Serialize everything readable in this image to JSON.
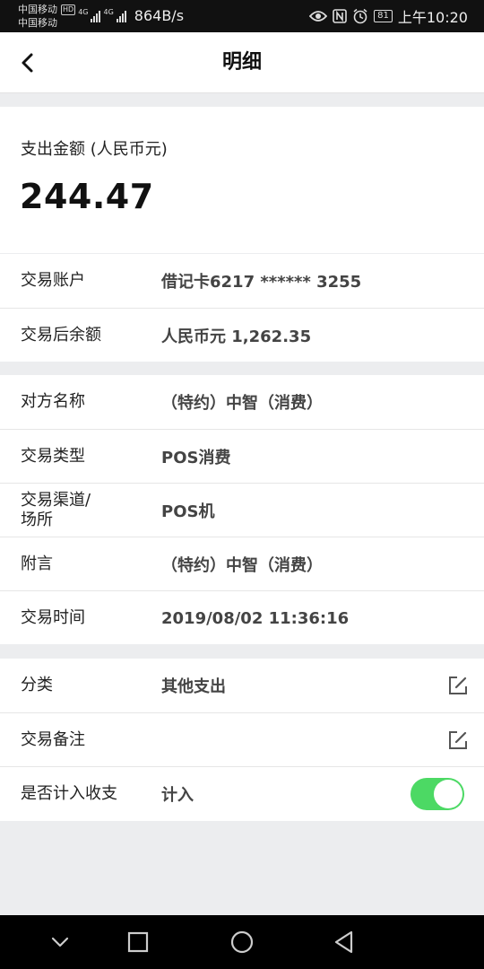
{
  "status_bar": {
    "carrier1": "中国移动",
    "carrier2": "中国移动",
    "hd": "HD",
    "net1": "4G",
    "net2": "4G",
    "speed": "864B/s",
    "battery": "81",
    "time": "上午10:20",
    "icons": [
      "eye-icon",
      "nfc-icon",
      "alarm-icon"
    ]
  },
  "header": {
    "title": "明细",
    "back_icon": "chevron-left-icon"
  },
  "amount": {
    "label": "支出金额 (人民币元)",
    "value": "244.47"
  },
  "section1": [
    {
      "label": "交易账户",
      "value": "借记卡6217 ****** 3255"
    },
    {
      "label": "交易后余额",
      "value": "人民币元 1,262.35"
    }
  ],
  "section2": [
    {
      "label": "对方名称",
      "value": "（特约）中智（消费）"
    },
    {
      "label": "交易类型",
      "value": "POS消费"
    },
    {
      "label_line1": "交易渠道/",
      "label_line2": "场所",
      "value": "POS机"
    },
    {
      "label": "附言",
      "value": "（特约）中智（消费）"
    },
    {
      "label": "交易时间",
      "value": "2019/08/02 11:36:16"
    }
  ],
  "section3": {
    "category": {
      "label": "分类",
      "value": "其他支出",
      "icon": "edit-icon"
    },
    "remark": {
      "label": "交易备注",
      "value": "",
      "icon": "edit-icon"
    },
    "include": {
      "label": "是否计入收支",
      "value": "计入",
      "toggle_on": true
    }
  },
  "colors": {
    "toggle_on": "#4cd964",
    "page_bg": "#ecedef"
  },
  "system_nav": [
    "back-triangle-icon",
    "home-circle-icon",
    "recents-square-icon",
    "notification-down-icon"
  ]
}
